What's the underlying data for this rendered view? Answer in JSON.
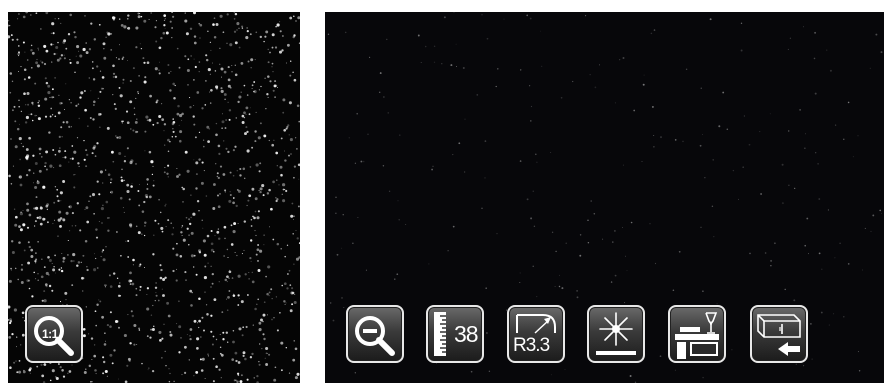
{
  "left_panel": {
    "zoom_button_label": "1:1",
    "zoom_button_icon": "magnifier-actual-size-icon"
  },
  "toolbar": {
    "buttons": [
      {
        "icon": "zoom-out-icon",
        "label": ""
      },
      {
        "icon": "thickness-ruler-icon",
        "label": "38"
      },
      {
        "icon": "edge-radius-icon",
        "label": "R3.3"
      },
      {
        "icon": "sparkle-finish-icon",
        "label": ""
      },
      {
        "icon": "kitchen-countertop-icon",
        "label": ""
      },
      {
        "icon": "back-to-cabinet-icon",
        "label": ""
      }
    ]
  },
  "colors": {
    "panel_background": "#050505",
    "button_border": "#e8e8e8",
    "icon_white": "#ffffff"
  }
}
